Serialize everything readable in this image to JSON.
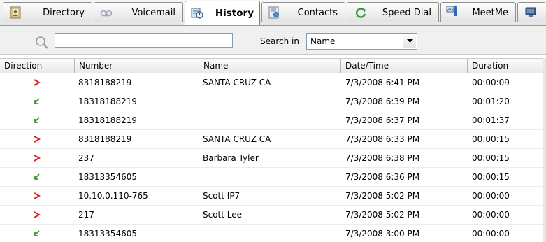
{
  "tabs": [
    {
      "label": "Directory",
      "icon": "directory-icon",
      "active": false
    },
    {
      "label": "Voicemail",
      "icon": "voicemail-icon",
      "active": false
    },
    {
      "label": "History",
      "icon": "history-icon",
      "active": true
    },
    {
      "label": "Contacts",
      "icon": "contacts-icon",
      "active": false
    },
    {
      "label": "Speed Dial",
      "icon": "speed-dial-icon",
      "active": false
    },
    {
      "label": "MeetMe",
      "icon": "meetme-icon",
      "active": false
    }
  ],
  "search": {
    "query": "",
    "search_in_label": "Search in",
    "search_in_value": "Name"
  },
  "table": {
    "columns": [
      "Direction",
      "Number",
      "Name",
      "Date/Time",
      "Duration"
    ],
    "rows": [
      {
        "direction": "outgoing",
        "number": "8318188219",
        "name": "SANTA CRUZ  CA",
        "datetime": "7/3/2008 6:41 PM",
        "duration": "00:00:09"
      },
      {
        "direction": "incoming",
        "number": "18318188219",
        "name": "",
        "datetime": "7/3/2008 6:39 PM",
        "duration": "00:01:20"
      },
      {
        "direction": "incoming",
        "number": "18318188219",
        "name": "",
        "datetime": "7/3/2008 6:37 PM",
        "duration": "00:01:37"
      },
      {
        "direction": "outgoing",
        "number": "8318188219",
        "name": "SANTA CRUZ  CA",
        "datetime": "7/3/2008 6:33 PM",
        "duration": "00:00:15"
      },
      {
        "direction": "outgoing",
        "number": "237",
        "name": "Barbara Tyler",
        "datetime": "7/3/2008 6:38 PM",
        "duration": "00:00:15"
      },
      {
        "direction": "incoming",
        "number": "18313354605",
        "name": "",
        "datetime": "7/3/2008 6:36 PM",
        "duration": "00:00:15"
      },
      {
        "direction": "outgoing",
        "number": "10.10.0.110-765",
        "name": "Scott IP7",
        "datetime": "7/3/2008 5:02 PM",
        "duration": "00:00:00"
      },
      {
        "direction": "outgoing",
        "number": "217",
        "name": "Scott Lee",
        "datetime": "7/3/2008 5:02 PM",
        "duration": "00:00:00"
      },
      {
        "direction": "incoming",
        "number": "18313354605",
        "name": "",
        "datetime": "7/3/2008 3:00 PM",
        "duration": "00:00:00"
      }
    ]
  },
  "colors": {
    "outgoing": "#d81e1e",
    "incoming": "#3a9a2a",
    "border": "#8f8f8f"
  }
}
